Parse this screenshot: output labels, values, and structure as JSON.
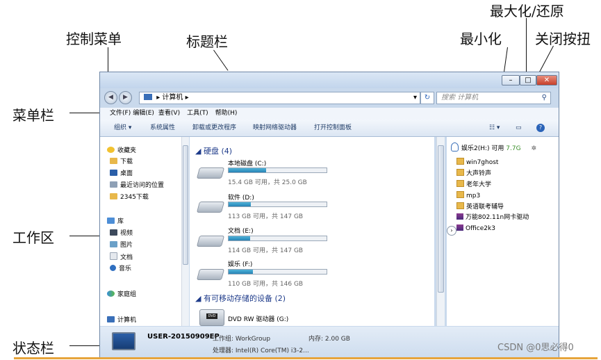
{
  "callouts": {
    "control_menu": "控制菜单",
    "title_bar": "标题栏",
    "maximize_restore": "最大化/还原",
    "minimize": "最小化",
    "close_button": "关闭按扭",
    "menu_bar": "菜单栏",
    "work_area": "工作区",
    "status_bar": "状态栏"
  },
  "address": {
    "path": "▸ 计算机 ▸",
    "search_placeholder": "搜索 计算机"
  },
  "menu": [
    "文件(F)",
    "编辑(E)",
    "查看(V)",
    "工具(T)",
    "帮助(H)"
  ],
  "toolbar": [
    "组织 ▾",
    "系统属性",
    "卸载或更改程序",
    "映射网络驱动器",
    "打开控制面板"
  ],
  "nav": {
    "favorites": "收藏夹",
    "downloads": "下载",
    "desktop": "桌面",
    "recent": "最近访问的位置",
    "dl2345": "2345下载",
    "libraries": "库",
    "videos": "视频",
    "pictures": "图片",
    "documents": "文档",
    "music": "音乐",
    "homegroup": "家庭组",
    "computer": "计算机"
  },
  "main": {
    "hdd_group": "◢ 硬盘 (4)",
    "drives": [
      {
        "name": "本地磁盘 (C:)",
        "info": "15.4 GB 可用，共 25.0 GB",
        "used": 0.38
      },
      {
        "name": "软件 (D:)",
        "info": "113 GB 可用，共 147 GB",
        "used": 0.23
      },
      {
        "name": "文档 (E:)",
        "info": "114 GB 可用，共 147 GB",
        "used": 0.22
      },
      {
        "name": "娱乐 (F:)",
        "info": "110 GB 可用，共 146 GB",
        "used": 0.25
      }
    ],
    "removable_group": "◢ 有可移动存储的设备 (2)",
    "dvd": "DVD RW 驱动器 (G:)",
    "dvd_badge": "DVD"
  },
  "preview": {
    "drive_label": "娱乐2(H:) 可用",
    "drive_free": "7.7G",
    "files": [
      "win7ghost",
      "大声铃声",
      "老年大学",
      "mp3",
      "英语联考辅导",
      "万能802.11n网卡驱动",
      "Office2k3"
    ]
  },
  "status": {
    "computer_name": "USER-20150909EP",
    "workgroup": "工作组: WorkGroup",
    "memory": "内存: 2.00 GB",
    "processor": "处理器: Intel(R) Core(TM) i3-2..."
  },
  "watermark": "CSDN @0思必得0",
  "colors": {
    "accent": "#2783b5",
    "window_chrome": "#c9d9ec",
    "close_red": "#c6402b"
  }
}
